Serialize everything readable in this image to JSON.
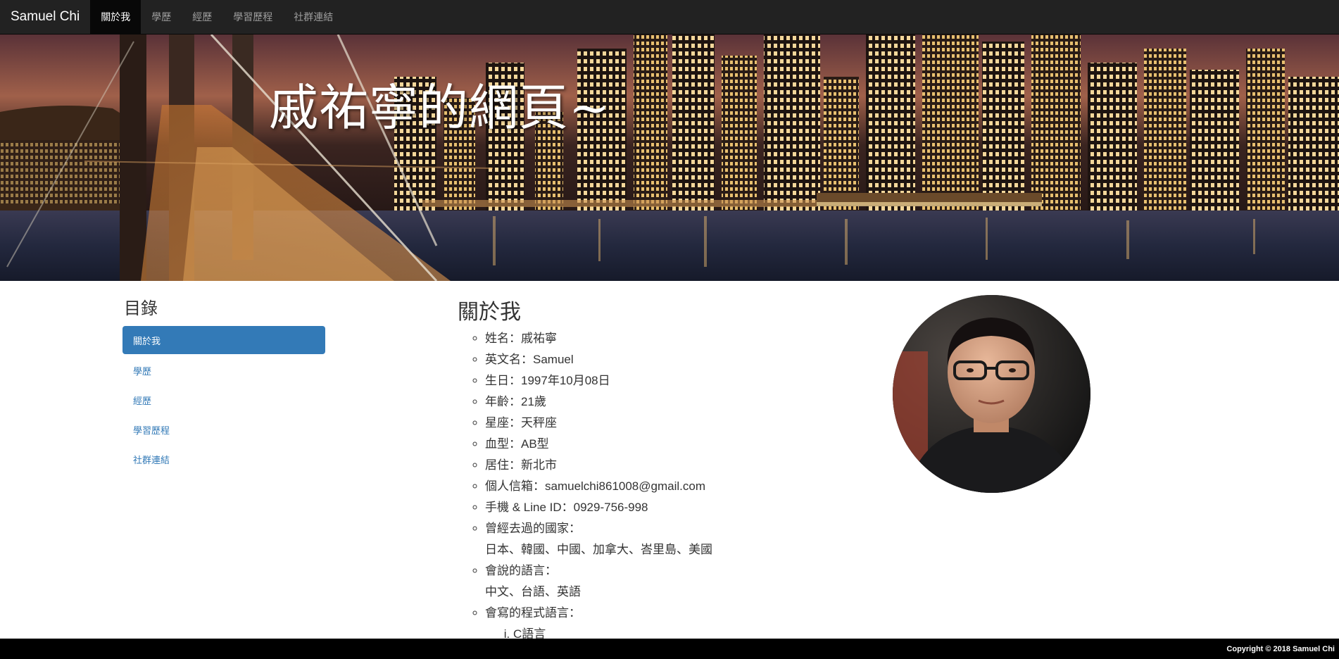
{
  "navbar": {
    "brand": "Samuel Chi",
    "items": [
      {
        "label": "關於我"
      },
      {
        "label": "學歷"
      },
      {
        "label": "經歷"
      },
      {
        "label": "學習歷程"
      },
      {
        "label": "社群連結"
      }
    ]
  },
  "hero": {
    "title": "戚祐寧的網頁~"
  },
  "sidebar": {
    "title": "目錄",
    "items": [
      {
        "label": "關於我"
      },
      {
        "label": "學歷"
      },
      {
        "label": "經歷"
      },
      {
        "label": "學習歷程"
      },
      {
        "label": "社群連結"
      }
    ]
  },
  "main": {
    "title": "關於我",
    "info": [
      "姓名：戚祐寧",
      "英文名：Samuel",
      "生日：1997年10月08日",
      "年齡：21歲",
      "星座：天秤座",
      "血型：AB型",
      "居住：新北市",
      "個人信箱：samuelchi861008@gmail.com",
      "手機 & Line ID：0929-756-998"
    ],
    "countries_label": "曾經去過的國家：",
    "countries_value": "日本、韓國、中國、加拿大、峇里島、美國",
    "languages_label": "會說的語言：",
    "languages_value": "中文、台語、英語",
    "programming_label": "會寫的程式語言：",
    "programming_items": [
      "C語言"
    ]
  },
  "footer": {
    "text": "Copyright © 2018 Samuel Chi"
  },
  "colors": {
    "navbar_bg": "#222222",
    "active_nav_bg": "#080808",
    "sidebar_active": "#337ab7",
    "link": "#337ab7",
    "footer_bg": "#000000"
  },
  "icons": {
    "avatar": "profile-photo"
  }
}
